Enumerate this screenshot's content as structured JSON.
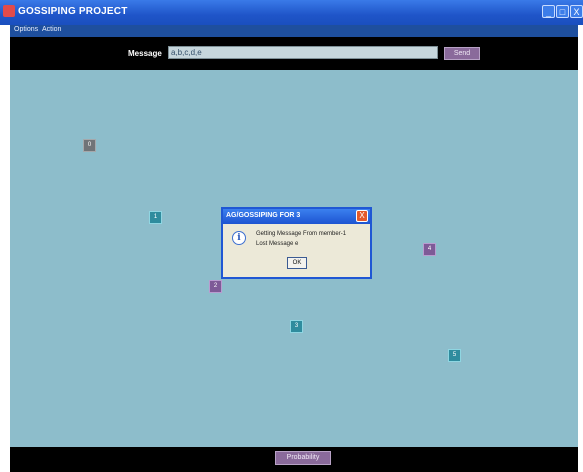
{
  "window": {
    "title": "GOSSIPING PROJECT",
    "controls": {
      "minimize": "_",
      "maximize": "□",
      "close": "X"
    }
  },
  "menu": {
    "items": [
      "Options",
      "Action"
    ]
  },
  "toolbar": {
    "message_label": "Message",
    "message_value": "a,b,c,d,e",
    "send_label": "Send"
  },
  "nodes": [
    {
      "label": "0",
      "color": "gray"
    },
    {
      "label": "1",
      "color": "teal"
    },
    {
      "label": "2",
      "color": "purple"
    },
    {
      "label": "3",
      "color": "teal"
    },
    {
      "label": "4",
      "color": "purple"
    },
    {
      "label": "5",
      "color": "teal"
    }
  ],
  "dialog": {
    "title": "AG/GOSSIPING FOR 3",
    "close": "X",
    "icon": "info-icon",
    "line1": "Getting Message From member-1",
    "line2": "Lost Message e",
    "ok_label": "OK"
  },
  "bottom": {
    "probability_label": "Probability"
  },
  "colors": {
    "canvas": "#8dbdcb",
    "title_bar": "#1f55c9",
    "node_teal": "#2f8c9e",
    "node_purple": "#7e5a97",
    "button": "#8a6a9b"
  }
}
